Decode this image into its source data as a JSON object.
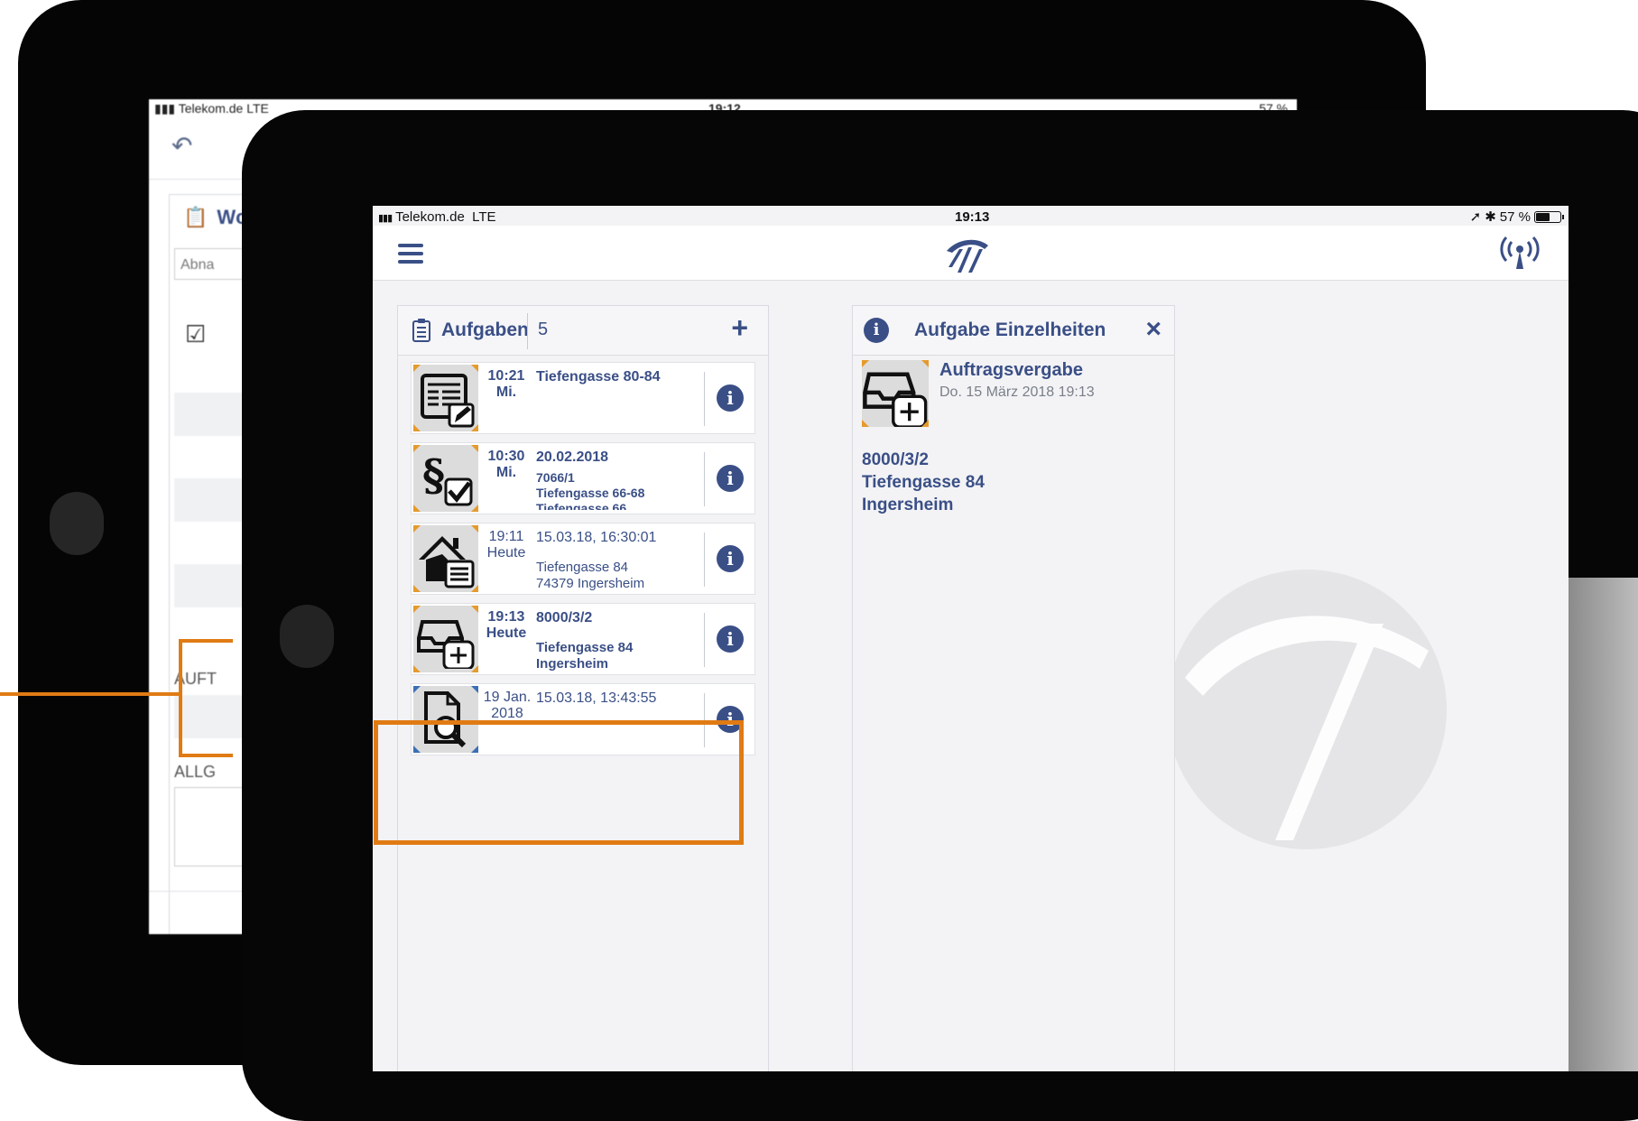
{
  "back_screen": {
    "status_carrier": "Telekom.de",
    "status_network": "LTE",
    "status_time": "19:12",
    "status_battery": "57 %",
    "panel_title_fragment": "Wc",
    "input_fragment": "Abna",
    "label_auft": "AUFT",
    "label_allg": "ALLG"
  },
  "status_bar": {
    "carrier": "Telekom.de",
    "network": "LTE",
    "time": "19:13",
    "battery": "57 %",
    "battery_level": 0.57
  },
  "tasks_panel": {
    "title": "Aufgaben",
    "count": "5",
    "add_label": "+",
    "info_glyph": "i",
    "items": [
      {
        "time": "10:21",
        "day": "Mi.",
        "line1": "Tiefengasse 80-84",
        "line2": "",
        "line3": "",
        "icon": "form-edit-icon"
      },
      {
        "time": "10:30",
        "day": "Mi.",
        "line1": "20.02.2018",
        "line2": "7066/1",
        "line3": "Tiefengasse 66-68",
        "line4": "Tiefengasse 66…",
        "icon": "paragraph-check-icon"
      },
      {
        "time": "19:11",
        "day": "Heute",
        "line1": "15.03.18, 16:30:01",
        "line2": "Tiefengasse 84",
        "line3": "74379 Ingersheim",
        "icon": "house-list-icon"
      },
      {
        "time": "19:13",
        "day": "Heute",
        "line1": "8000/3/2",
        "line2": "Tiefengasse 84",
        "line3": "Ingersheim",
        "icon": "inbox-add-icon"
      },
      {
        "time": "19 Jan.",
        "day": "2018",
        "line1": "15.03.18, 13:43:55",
        "line2": "",
        "line3": "",
        "icon": "document-search-icon"
      }
    ]
  },
  "details_panel": {
    "title": "Aufgabe Einzelheiten",
    "close_label": "×",
    "info_glyph": "i",
    "task_title": "Auftragsvergabe",
    "task_date": "Do. 15 März 2018 19:13",
    "lines": [
      "8000/3/2",
      "Tiefengasse 84",
      "Ingersheim"
    ]
  },
  "colors": {
    "accent": "#3a4f86",
    "highlight": "#e07b14",
    "icon_corner": "#e59a2c"
  }
}
